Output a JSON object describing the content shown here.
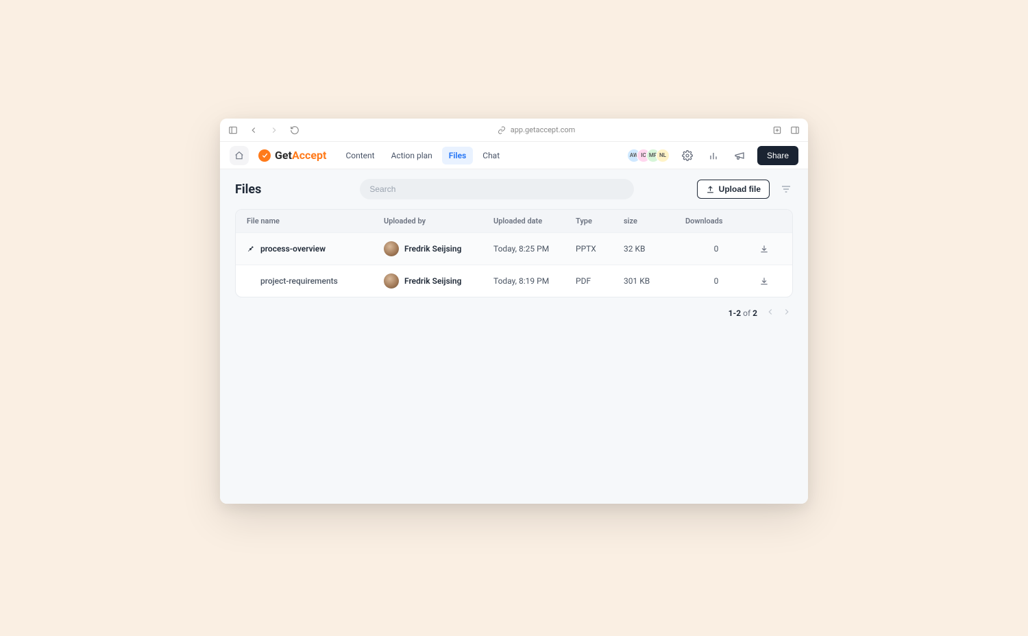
{
  "browser": {
    "url": "app.getaccept.com"
  },
  "brand": {
    "part1": "Get",
    "part2": "Accept"
  },
  "nav": {
    "tabs": [
      {
        "label": "Content"
      },
      {
        "label": "Action plan"
      },
      {
        "label": "Files"
      },
      {
        "label": "Chat"
      }
    ],
    "activeIndex": 2
  },
  "header": {
    "avatars": [
      "AW",
      "IC",
      "MP",
      "NL"
    ],
    "share": "Share"
  },
  "page": {
    "title": "Files",
    "searchPlaceholder": "Search",
    "uploadLabel": "Upload file"
  },
  "table": {
    "columns": [
      "File name",
      "Uploaded by",
      "Uploaded date",
      "Type",
      "size",
      "Downloads"
    ],
    "rows": [
      {
        "pinned": true,
        "selected": true,
        "name": "process-overview",
        "uploaded_by": "Fredrik Seijsing",
        "uploaded_date": "Today, 8:25 PM",
        "type": "PPTX",
        "size": "32 KB",
        "downloads": "0"
      },
      {
        "pinned": false,
        "selected": false,
        "name": "project-requirements",
        "uploaded_by": "Fredrik Seijsing",
        "uploaded_date": "Today, 8:19 PM",
        "type": "PDF",
        "size": "301 KB",
        "downloads": "0"
      }
    ]
  },
  "pagination": {
    "range": "1-2",
    "of": "of",
    "total": "2"
  }
}
